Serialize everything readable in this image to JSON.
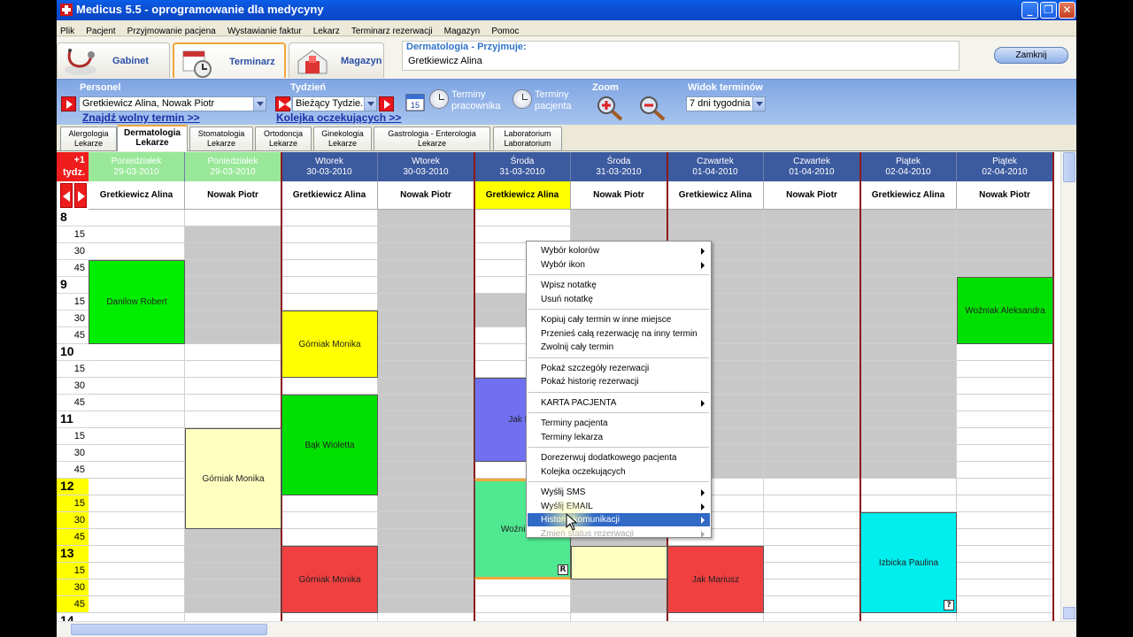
{
  "window": {
    "title": "Medicus 5.5 - oprogramowanie dla medycyny"
  },
  "menu": [
    "Plik",
    "Pacjent",
    "Przyjmowanie pacjena",
    "Wystawianie faktur",
    "Lekarz",
    "Terminarz rezerwacji",
    "Magazyn",
    "Pomoc"
  ],
  "modules": {
    "gabinet": "Gabinet",
    "terminarz": "Terminarz",
    "magazyn": "Magazyn"
  },
  "info": {
    "title": "Dermatologia - Przyjmuje:",
    "doctor": "Gretkiewicz Alina"
  },
  "close_button": "Zamknij",
  "toolbar": {
    "personel_label": "Personel",
    "personel_value": "Gretkiewicz Alina, Nowak Piotr",
    "find_link": "Znajdź wolny termin >>",
    "tydzien_label": "Tydzień",
    "tydzien_value": "Bieżący Tydzie...",
    "queue_link": "Kolejka oczekujących >>",
    "terminy_pracownika": [
      "Terminy",
      "pracownika"
    ],
    "terminy_pacjenta": [
      "Terminy",
      "pacjenta"
    ],
    "calendar_day": "15",
    "zoom_label": "Zoom",
    "widok_label": "Widok terminów",
    "widok_value": "7 dni tygodnia"
  },
  "dept_tabs": [
    {
      "l1": "Alergologia",
      "l2": "Lekarze"
    },
    {
      "l1": "Dermatologia",
      "l2": "Lekarze"
    },
    {
      "l1": "Stomatologia",
      "l2": "Lekarze"
    },
    {
      "l1": "Ortodoncja",
      "l2": "Lekarze"
    },
    {
      "l1": "Ginekologia",
      "l2": "Lekarze"
    },
    {
      "l1": "Gastrologia - Enterologia",
      "l2": "Lekarze"
    },
    {
      "l1": "Laboratorium",
      "l2": "Laboratorium"
    }
  ],
  "grid": {
    "plus_week": [
      "+1",
      "tydz."
    ],
    "days": [
      {
        "name": "Poniedziałek",
        "date": "29-03-2010",
        "color": "#99e899",
        "text": "#ffffff"
      },
      {
        "name": "Poniedziałek",
        "date": "29-03-2010",
        "color": "#99e899",
        "text": "#ffffff"
      },
      {
        "name": "Wtorek",
        "date": "30-03-2010",
        "color": "#3c5a9f",
        "text": "#ffffff"
      },
      {
        "name": "Wtorek",
        "date": "30-03-2010",
        "color": "#3c5a9f",
        "text": "#ffffff"
      },
      {
        "name": "Środa",
        "date": "31-03-2010",
        "color": "#3c5a9f",
        "text": "#ffffff"
      },
      {
        "name": "Środa",
        "date": "31-03-2010",
        "color": "#3c5a9f",
        "text": "#ffffff"
      },
      {
        "name": "Czwartek",
        "date": "01-04-2010",
        "color": "#3c5a9f",
        "text": "#ffffff"
      },
      {
        "name": "Czwartek",
        "date": "01-04-2010",
        "color": "#3c5a9f",
        "text": "#ffffff"
      },
      {
        "name": "Piątek",
        "date": "02-04-2010",
        "color": "#3c5a9f",
        "text": "#ffffff"
      },
      {
        "name": "Piątek",
        "date": "02-04-2010",
        "color": "#3c5a9f",
        "text": "#ffffff"
      }
    ],
    "doctors": [
      "Gretkiewicz Alina",
      "Nowak Piotr",
      "Gretkiewicz Alina",
      "Nowak Piotr",
      "Gretkiewicz Alina",
      "Nowak Piotr",
      "Gretkiewicz Alina",
      "Nowak Piotr",
      "Gretkiewicz Alina",
      "Nowak Piotr"
    ],
    "times": [
      "8",
      "15",
      "30",
      "45",
      "9",
      "15",
      "30",
      "45",
      "10",
      "15",
      "30",
      "45",
      "11",
      "15",
      "30",
      "45",
      "12",
      "15",
      "30",
      "45",
      "13",
      "15",
      "30",
      "45",
      "14"
    ],
    "appointments": [
      {
        "name": "Danilow Robert",
        "color": "#00ee00"
      },
      {
        "name": "Górniak Monika",
        "color": "#ffff00"
      },
      {
        "name": "Bąk Wioletta",
        "color": "#00e000"
      },
      {
        "name": "Górniak Monika",
        "color": "#ffffc0"
      },
      {
        "name": "Górniak Monika",
        "color": "#f04040"
      },
      {
        "name": "Jak Ma",
        "color": "#7070f0"
      },
      {
        "name": "Woźniak Al",
        "color": "#50e890",
        "badge": "R"
      },
      {
        "name": "Jak Mariusz",
        "color": "#f04040"
      },
      {
        "name": "Izbicka Paulina",
        "color": "#00eeee",
        "badge": "?"
      },
      {
        "name": "Woźniak Aleksandra",
        "color": "#00e000"
      }
    ]
  },
  "context_menu": [
    {
      "label": "Wybór kolorów",
      "sub": true
    },
    {
      "label": "Wybór ikon",
      "sub": true
    },
    {
      "sep": true
    },
    {
      "label": "Wpisz notatkę"
    },
    {
      "label": "Usuń notatkę"
    },
    {
      "sep": true
    },
    {
      "label": "Kopiuj cały termin w inne miejsce"
    },
    {
      "label": "Przenieś całą rezerwację na inny termin"
    },
    {
      "label": "Zwolnij cały termin"
    },
    {
      "sep": true
    },
    {
      "label": "Pokaż szczegóły rezerwacji"
    },
    {
      "label": "Pokaż historię rezerwacji"
    },
    {
      "sep": true
    },
    {
      "label": "KARTA PACJENTA",
      "sub": true
    },
    {
      "sep": true
    },
    {
      "label": "Terminy pacjenta"
    },
    {
      "label": "Terminy lekarza"
    },
    {
      "sep": true
    },
    {
      "label": "Dorezerwuj dodatkowego pacjenta"
    },
    {
      "label": "Kolejka oczekujących"
    },
    {
      "sep": true
    },
    {
      "label": "Wyślij SMS",
      "sub": true
    },
    {
      "label": "Wyślij EMAIL",
      "sub": true
    },
    {
      "label": "Historia komunikacji",
      "sub": true,
      "highlight": true
    },
    {
      "label": "Zmień status rezerwacji",
      "sub": true,
      "disabled": true
    }
  ]
}
